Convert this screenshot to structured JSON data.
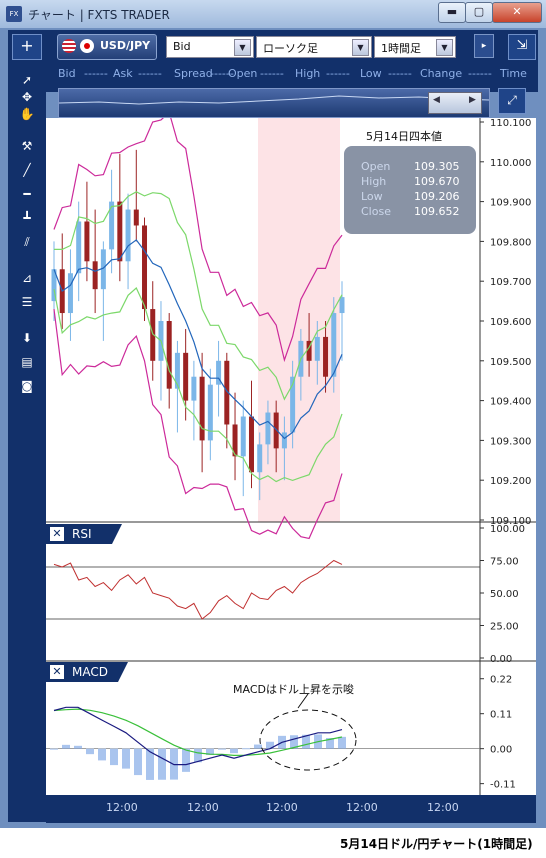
{
  "window": {
    "title": "チャート | FXTS TRADER",
    "icon": "FX",
    "minimize": "▬",
    "maximize": "▢",
    "close": "✕"
  },
  "toolbar": {
    "add_label": "+",
    "symbol": "USD/JPY",
    "price_type": "Bid",
    "chart_type": "ローソク足",
    "timeframe": "1時間足",
    "expand_label": "⇲"
  },
  "quote_bar": {
    "bid_label": "Bid",
    "bid_value": "------",
    "ask_label": "Ask",
    "ask_value": "------",
    "spread_label": "Spread",
    "spread_value": "------",
    "open_label": "Open",
    "open_value": "------",
    "high_label": "High",
    "high_value": "------",
    "low_label": "Low",
    "low_value": "------",
    "change_label": "Change",
    "change_value": "------",
    "time_label": "Time"
  },
  "ohlc": {
    "title": "5月14日四本値",
    "open_label": "Open",
    "open_value": "109.305",
    "high_label": "High",
    "high_value": "109.670",
    "low_label": "Low",
    "low_value": "109.206",
    "close_label": "Close",
    "close_value": "109.652"
  },
  "price_axis": [
    "110.100",
    "110.000",
    "109.900",
    "109.800",
    "109.700",
    "109.600",
    "109.500",
    "109.400",
    "109.300",
    "109.200",
    "109.100"
  ],
  "rsi": {
    "label": "RSI",
    "ticks": [
      "100.00",
      "75.00",
      "50.00",
      "25.00",
      "0.00"
    ]
  },
  "macd": {
    "label": "MACD",
    "ticks": [
      "0.22",
      "0.11",
      "0.00",
      "-0.11"
    ],
    "annotation": "MACDはドル上昇を示唆"
  },
  "time_axis": [
    "12:00",
    "12:00",
    "12:00",
    "12:00",
    "12:00"
  ],
  "caption": "5月14日ドル/円チャート(1時間足)",
  "colors": {
    "candle_up": "#7bb6e8",
    "candle_down": "#9b2222",
    "bollinger_outer": "#cc2a9a",
    "bollinger_inner": "#7cd86a",
    "moving_average": "#2266bb",
    "rsi_line": "#c03030",
    "macd_line": "#1a1a80",
    "signal_line": "#3ac03a",
    "histogram": "#a9c4ee",
    "highlight": "#fde3e6"
  },
  "chart_data": [
    {
      "type": "line",
      "y_axis_label": "",
      "ylim": [
        109.1,
        110.1
      ],
      "series_candles": [
        [
          109.65,
          109.8,
          109.6,
          109.73
        ],
        [
          109.73,
          109.82,
          109.58,
          109.62
        ],
        [
          109.62,
          109.78,
          109.55,
          109.72
        ],
        [
          109.72,
          109.9,
          109.65,
          109.85
        ],
        [
          109.85,
          109.95,
          109.7,
          109.75
        ],
        [
          109.75,
          109.88,
          109.62,
          109.68
        ],
        [
          109.68,
          109.8,
          109.55,
          109.78
        ],
        [
          109.78,
          109.98,
          109.72,
          109.9
        ],
        [
          109.9,
          110.02,
          109.7,
          109.75
        ],
        [
          109.75,
          109.92,
          109.68,
          109.88
        ],
        [
          109.88,
          110.03,
          109.8,
          109.84
        ],
        [
          109.84,
          109.86,
          109.6,
          109.63
        ],
        [
          109.63,
          109.7,
          109.45,
          109.5
        ],
        [
          109.5,
          109.65,
          109.4,
          109.6
        ],
        [
          109.6,
          109.62,
          109.38,
          109.43
        ],
        [
          109.43,
          109.55,
          109.32,
          109.52
        ],
        [
          109.52,
          109.58,
          109.35,
          109.4
        ],
        [
          109.4,
          109.5,
          109.3,
          109.46
        ],
        [
          109.46,
          109.52,
          109.22,
          109.3
        ],
        [
          109.3,
          109.48,
          109.25,
          109.44
        ],
        [
          109.44,
          109.55,
          109.36,
          109.5
        ],
        [
          109.5,
          109.52,
          109.28,
          109.34
        ],
        [
          109.34,
          109.42,
          109.2,
          109.26
        ],
        [
          109.26,
          109.4,
          109.16,
          109.36
        ],
        [
          109.36,
          109.45,
          109.18,
          109.22
        ],
        [
          109.22,
          109.32,
          109.15,
          109.29
        ],
        [
          109.29,
          109.4,
          109.24,
          109.37
        ],
        [
          109.37,
          109.4,
          109.22,
          109.28
        ],
        [
          109.28,
          109.36,
          109.2,
          109.32
        ],
        [
          109.32,
          109.5,
          109.28,
          109.46
        ],
        [
          109.46,
          109.58,
          109.4,
          109.55
        ],
        [
          109.55,
          109.62,
          109.46,
          109.5
        ],
        [
          109.5,
          109.6,
          109.44,
          109.56
        ],
        [
          109.56,
          109.6,
          109.42,
          109.46
        ],
        [
          109.46,
          109.66,
          109.42,
          109.62
        ],
        [
          109.62,
          109.7,
          109.5,
          109.66
        ]
      ]
    },
    {
      "type": "line",
      "name": "",
      "ylim": [
        0,
        100
      ],
      "values": [
        72,
        70,
        73,
        60,
        62,
        55,
        58,
        52,
        60,
        64,
        57,
        62,
        50,
        48,
        46,
        40,
        38,
        42,
        30,
        35,
        44,
        48,
        42,
        38,
        50,
        46,
        45,
        52,
        55,
        50,
        58,
        62,
        65,
        70,
        75,
        72
      ]
    },
    {
      "type": "line",
      "name": "",
      "ylim": [
        -0.13,
        0.26
      ],
      "values": [
        0.12,
        0.13,
        0.13,
        0.11,
        0.09,
        0.07,
        0.05,
        0.02,
        -0.01,
        -0.03,
        -0.05,
        -0.05,
        -0.04,
        -0.03,
        -0.02,
        -0.03,
        -0.02,
        -0.01,
        0.0,
        0.02,
        0.03,
        0.04,
        0.05,
        0.05,
        0.06
      ]
    }
  ]
}
